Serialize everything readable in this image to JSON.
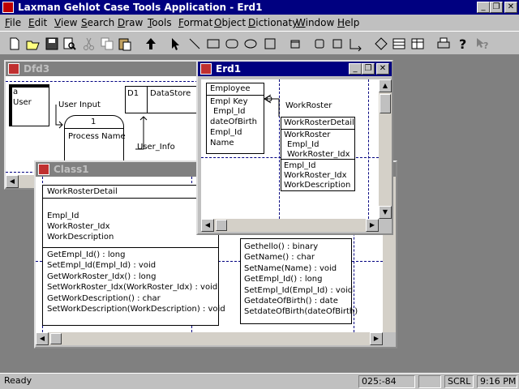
{
  "app": {
    "title": "Laxman Gehlot Case Tools Application - Erd1"
  },
  "title_buttons": {
    "minimize": "_",
    "restore": "❐",
    "close": "✕"
  },
  "menu": {
    "items": [
      "File",
      "Edit",
      "View",
      "Search",
      "Draw",
      "Tools",
      "Format",
      "Object",
      "Dictionaty",
      "Window",
      "Help"
    ]
  },
  "toolbar": {
    "icons": [
      "new-icon",
      "open-icon",
      "save-icon",
      "print-preview-icon",
      "cut-icon",
      "copy-icon",
      "paste-icon",
      "arrow-up-icon",
      "pointer-icon",
      "line-icon",
      "rectangle-icon",
      "rounded-rect-icon",
      "ellipse-icon",
      "square-icon",
      "rounded-square-icon",
      "small-rect-icon",
      "connector-icon",
      "diamond-icon",
      "list-box-icon",
      "table-icon",
      "printer-icon",
      "help-icon",
      "context-help-icon"
    ]
  },
  "windows": {
    "dfd3": {
      "title": "Dfd3",
      "entity_label": "a",
      "entity_name": "User",
      "flow_user_input": "User Input",
      "process_number": "1",
      "process_name": "Process Name",
      "datastore_id": "D1",
      "datastore_name": "DataStore",
      "flow_user_info": "User_Info"
    },
    "class1": {
      "title": "Class1",
      "class_name": "WorkRosterDetail",
      "attributes": [
        "Empl_Id",
        "WorkRoster_Idx",
        "WorkDescription"
      ],
      "methods": [
        "GetEmpl_Id() : long",
        "SetEmpl_Id(Empl_Id) : void",
        "GetWorkRoster_Idx() : long",
        "SetWorkRoster_Idx(WorkRoster_Idx) : void",
        "GetWorkDescription() : char",
        "SetWorkDescription(WorkDescription) : void"
      ],
      "methods2": [
        "Gethello() : binary",
        "GetName() : char",
        "SetName(Name) : void",
        "GetEmpl_Id() : long",
        "SetEmpl_Id(Empl_Id) : void",
        "GetdateOfBirth() : date",
        "SetdateOfBirth(dateOfBirth)"
      ]
    },
    "erd1": {
      "title": "Erd1",
      "employee": {
        "name": "Employee",
        "fields": [
          "Empl Key",
          "Empl_Id",
          "dateOfBirth",
          "Empl_Id",
          "Name"
        ]
      },
      "relationship_label": "WorkRoster",
      "detail": {
        "name": "WorkRosterDetail",
        "fields": [
          "WorkRoster",
          "Empl_Id",
          "WorkRoster_Idx",
          "Empl_Id",
          "WorkRoster_Idx",
          "WorkDescription"
        ]
      }
    }
  },
  "status": {
    "text": "Ready",
    "coords": "025:-84",
    "scrl": "SCRL",
    "time": "9:16 PM"
  },
  "colors": {
    "active_title": "#000080",
    "inactive_title": "#808080",
    "face": "#c0c0c0",
    "desktop": "#808080"
  }
}
